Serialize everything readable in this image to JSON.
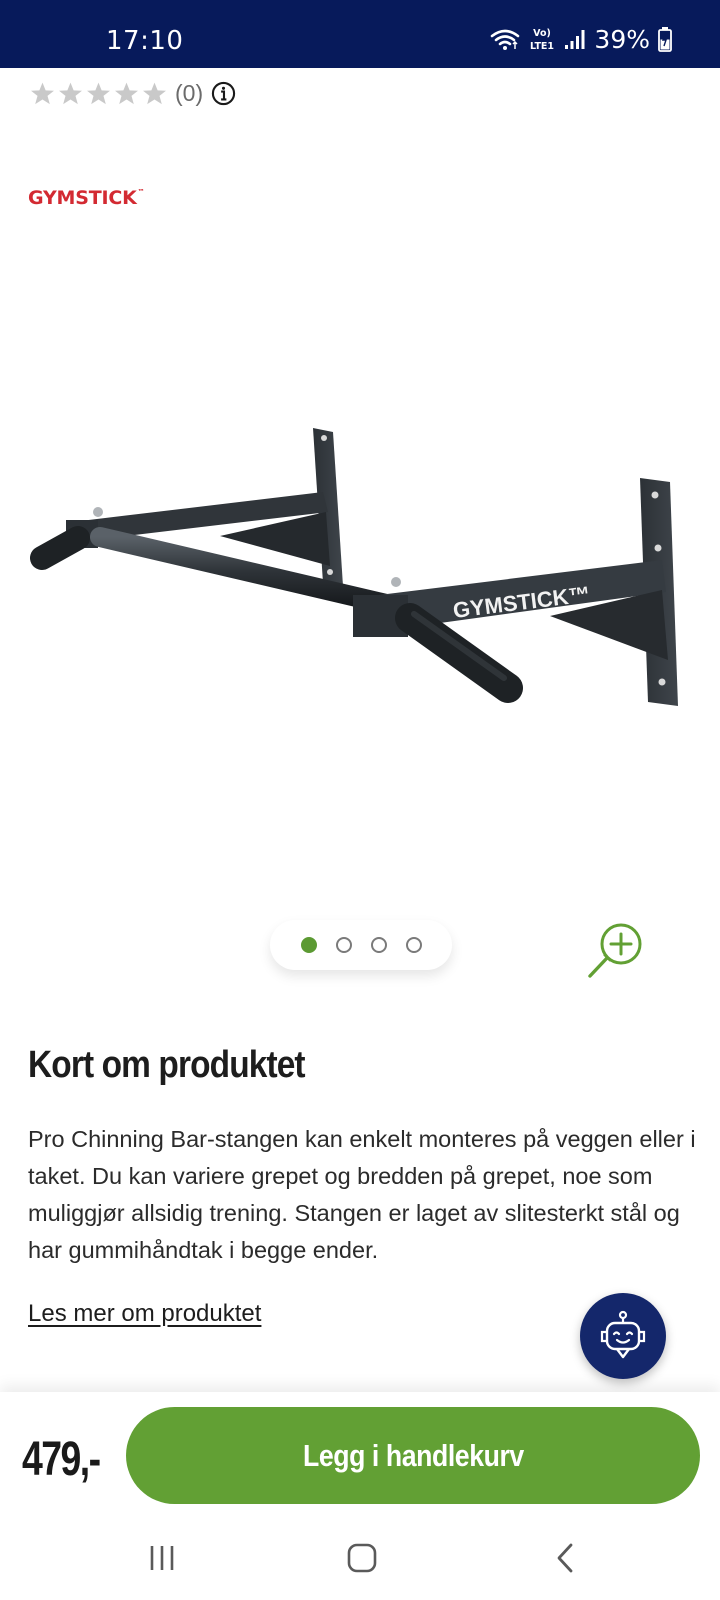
{
  "status_bar": {
    "time": "17:10",
    "network_label": "Vo) LTE1",
    "battery": "39%"
  },
  "rating": {
    "stars": 0,
    "max_stars": 5,
    "count": "(0)"
  },
  "brand": {
    "name": "GYMSTICK",
    "mark": "™",
    "color": "#d32a32"
  },
  "product_image": {
    "label": "GYMSTICK™"
  },
  "gallery": {
    "current_index": 1,
    "total": 4
  },
  "summary": {
    "title": "Kort om produktet",
    "text": "Pro Chinning Bar-stangen kan enkelt monteres på veggen eller i taket. Du kan variere grepet og bredden på grepet, noe som muliggjør allsidig trening. Stangen er laget av slitesterkt stål og har gummihåndtak i begge ender.",
    "read_more": "Les mer om produktet"
  },
  "purchase": {
    "price": "479,-",
    "button_label": "Legg i handlekurv",
    "accent_color": "#62a034"
  },
  "icons": {
    "zoom": "zoom-in-icon",
    "info": "info-icon",
    "chatbot": "chatbot-icon",
    "nav_recent": "recent-apps-icon",
    "nav_home": "home-icon",
    "nav_back": "back-icon"
  }
}
